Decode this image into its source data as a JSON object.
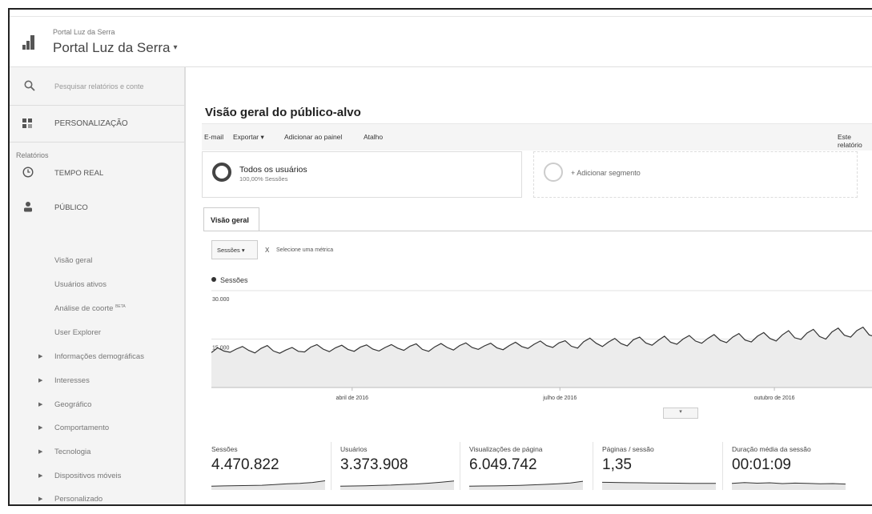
{
  "header": {
    "account_small": "Portal Luz da Serra",
    "account_name": "Portal Luz da Serra",
    "account_caret": "▾"
  },
  "sidebar": {
    "search_placeholder": "Pesquisar relatórios e conte",
    "customization": "PERSONALIZAÇÃO",
    "reports_label": "Relatórios",
    "realtime": "TEMPO REAL",
    "audience": "PÚBLICO",
    "audience_items": [
      "Visão geral",
      "Usuários ativos",
      "Análise de coorte",
      "User Explorer"
    ],
    "beta": "BETA",
    "expandable": [
      "Informações demográficas",
      "Interesses",
      "Geográfico",
      "Comportamento",
      "Tecnologia",
      "Dispositivos móveis",
      "Personalizado"
    ]
  },
  "main": {
    "title": "Visão geral do público-alvo",
    "toolbar": [
      "E-mail",
      "Exportar ▾",
      "Adicionar ao painel",
      "Atalho"
    ],
    "toolbar_right": "Este relatório",
    "segment": {
      "name": "Todos os usuários",
      "sub": "100,00% Sessões"
    },
    "add_segment": "+ Adicionar segmento",
    "tab": "Visão geral",
    "metric_select": "Sessões ▾",
    "metric_remove": "X",
    "metric_add": "Selecione uma métrica",
    "legend": "Sessões"
  },
  "chart_data": {
    "type": "area",
    "series": [
      {
        "name": "Sessões",
        "values": [
          10800,
          12300,
          11300,
          10900,
          11900,
          12700,
          11500,
          10700,
          12100,
          13000,
          11300,
          10600,
          11600,
          12400,
          11200,
          11000,
          12500,
          13300,
          11900,
          11100,
          12300,
          13100,
          11800,
          11200,
          12500,
          13200,
          11900,
          11300,
          12400,
          13300,
          12200,
          11500,
          12800,
          13500,
          11800,
          11200,
          12600,
          13600,
          12400,
          11600,
          13000,
          13800,
          12400,
          11800,
          12900,
          13700,
          12300,
          11700,
          13000,
          14000,
          12700,
          12100,
          13400,
          14400,
          13000,
          12400,
          13800,
          14500,
          12800,
          12200,
          14200,
          15300,
          13700,
          12700,
          14100,
          15200,
          13600,
          12900,
          14800,
          15600,
          13800,
          13100,
          14600,
          15900,
          14000,
          13400,
          15000,
          16100,
          14400,
          13700,
          15200,
          16400,
          14600,
          13900,
          15600,
          16700,
          14700,
          14100,
          15900,
          17000,
          15200,
          14400,
          16300,
          17600,
          15400,
          14900,
          16900,
          18000,
          15800,
          15000,
          17200,
          18400,
          16200,
          15600,
          17600,
          18700,
          16300,
          15700,
          17900
        ]
      }
    ],
    "xticks": [
      "abril de 2016",
      "julho de 2016",
      "outubro de 2016"
    ],
    "yticks": [
      "30.000",
      "15.000"
    ],
    "ylim": [
      0,
      30000
    ],
    "grid": true
  },
  "stats": [
    {
      "label": "Sessões",
      "value": "4.470.822",
      "trend": [
        3,
        3.2,
        3.4,
        3.5,
        3.7,
        4.2,
        4.8,
        5.2,
        5.9,
        7.2
      ]
    },
    {
      "label": "Usuários",
      "value": "3.373.908",
      "trend": [
        3,
        3.1,
        3.3,
        3.6,
        3.8,
        4.3,
        4.7,
        5.3,
        6.1,
        7.0
      ]
    },
    {
      "label": "Visualizações de página",
      "value": "6.049.742",
      "trend": [
        3,
        3.1,
        3.2,
        3.4,
        3.6,
        4.0,
        4.4,
        4.9,
        5.5,
        6.8
      ]
    },
    {
      "label": "Páginas / sessão",
      "value": "1,35",
      "trend": [
        6,
        5.9,
        5.7,
        5.6,
        5.5,
        5.4,
        5.3,
        5.2,
        5.2,
        5.1
      ]
    },
    {
      "label": "Duração média da sessão",
      "value": "00:01:09",
      "trend": [
        5.2,
        5.8,
        5.3,
        5.6,
        5.0,
        5.4,
        5.1,
        4.9,
        5.0,
        4.6
      ]
    }
  ]
}
